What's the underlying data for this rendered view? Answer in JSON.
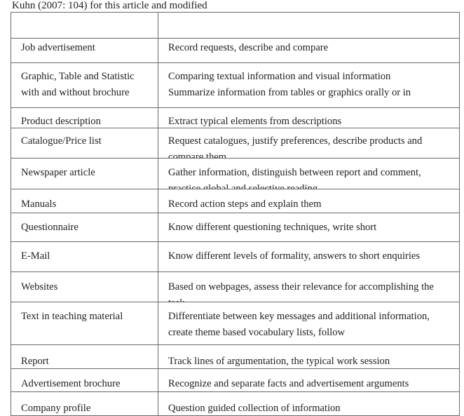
{
  "caption": "Kuhn (2007: 104) for this article and modified",
  "table": {
    "header": [
      "",
      ""
    ],
    "rows": [
      {
        "text_type": "Job advertisement",
        "activities": "Record requests, describe and compare"
      },
      {
        "text_type": "Graphic, Table and Statistic with and without brochure",
        "activities": "Comparing textual information and visual information\nSummarize information from tables or graphics orally or in"
      },
      {
        "text_type": "Product description",
        "activities": "Extract typical elements from descriptions"
      },
      {
        "text_type": "Catalogue/Price list",
        "activities": "Request catalogues, justify preferences, describe products and compare them"
      },
      {
        "text_type": "Newspaper article",
        "activities": "Gather information, distinguish between report and comment, practice global and selective reading"
      },
      {
        "text_type": "Manuals",
        "activities": "Record action steps and explain them"
      },
      {
        "text_type": "Questionnaire",
        "activities": "Know different questioning techniques, write short"
      },
      {
        "text_type": "E-Mail",
        "activities": "Know different levels of formality, answers to short enquiries"
      },
      {
        "text_type": "Websites",
        "activities": "Based on webpages, assess their relevance for accomplishing the task"
      },
      {
        "text_type": "Text in teaching material",
        "activities": "Differentiate between key messages and additional information, create theme based vocabulary lists, follow"
      },
      {
        "text_type": "Report",
        "activities": "Track lines of argumentation, the typical work session"
      },
      {
        "text_type": "Advertisement brochure",
        "activities": "Recognize and separate facts and advertisement arguments"
      },
      {
        "text_type": "Company profile",
        "activities": "Question guided collection of information"
      }
    ]
  }
}
